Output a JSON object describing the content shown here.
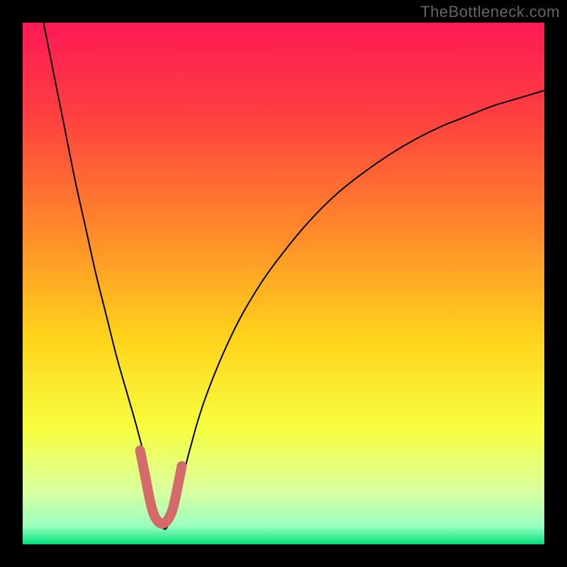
{
  "watermark": "TheBottleneck.com",
  "chart_data": {
    "type": "line",
    "title": "",
    "xlabel": "",
    "ylabel": "",
    "xlim": [
      0,
      100
    ],
    "ylim": [
      0,
      100
    ],
    "grid": false,
    "legend": false,
    "background_gradient": {
      "stops": [
        {
          "offset": 0.0,
          "color": "#ff1a56"
        },
        {
          "offset": 0.18,
          "color": "#ff4040"
        },
        {
          "offset": 0.4,
          "color": "#ff8a2a"
        },
        {
          "offset": 0.6,
          "color": "#ffd21a"
        },
        {
          "offset": 0.78,
          "color": "#f7ff40"
        },
        {
          "offset": 0.9,
          "color": "#d8ffa0"
        },
        {
          "offset": 0.965,
          "color": "#9affc0"
        },
        {
          "offset": 1.0,
          "color": "#00e07a"
        }
      ]
    },
    "series": [
      {
        "name": "curve",
        "stroke": "#000000",
        "stroke_width": 2,
        "x": [
          4,
          6,
          8,
          10,
          12,
          14,
          16,
          18,
          20,
          22,
          24,
          25,
          26,
          27,
          28,
          30,
          32,
          35,
          40,
          45,
          50,
          55,
          60,
          65,
          70,
          75,
          80,
          85,
          90,
          95,
          100
        ],
        "y": [
          100,
          90,
          80,
          70,
          61,
          52,
          44,
          36,
          29,
          22,
          14,
          9,
          5,
          3,
          4,
          10,
          18,
          28,
          40,
          49,
          56,
          62,
          67,
          71,
          74.5,
          77.5,
          80,
          82,
          84,
          85.5,
          87
        ]
      },
      {
        "name": "wide-highlight",
        "stroke": "#d46a6a",
        "stroke_width": 14,
        "linecap": "round",
        "x": [
          22.5,
          23.5,
          24.5,
          25.5,
          27.0,
          28.5,
          29.5,
          30.5
        ],
        "y": [
          18,
          13,
          8,
          5,
          4,
          6,
          10,
          15
        ]
      }
    ]
  }
}
